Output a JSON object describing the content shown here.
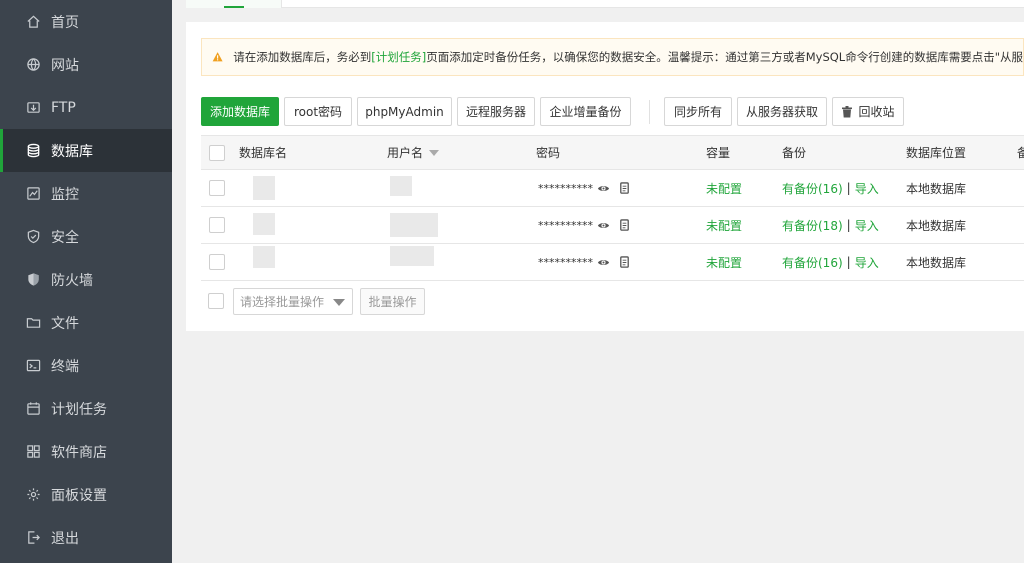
{
  "sidebar": {
    "items": [
      {
        "label": "首页",
        "icon": "home-icon"
      },
      {
        "label": "网站",
        "icon": "globe-icon"
      },
      {
        "label": "FTP",
        "icon": "ftp-icon"
      },
      {
        "label": "数据库",
        "icon": "database-icon",
        "active": true
      },
      {
        "label": "监控",
        "icon": "monitor-icon"
      },
      {
        "label": "安全",
        "icon": "shield-icon"
      },
      {
        "label": "防火墙",
        "icon": "firewall-icon"
      },
      {
        "label": "文件",
        "icon": "folder-icon"
      },
      {
        "label": "终端",
        "icon": "terminal-icon"
      },
      {
        "label": "计划任务",
        "icon": "calendar-icon"
      },
      {
        "label": "软件商店",
        "icon": "apps-icon"
      },
      {
        "label": "面板设置",
        "icon": "gear-icon"
      },
      {
        "label": "退出",
        "icon": "logout-icon"
      }
    ]
  },
  "notice": {
    "before": "请在添加数据库后，务必到",
    "link": "[计划任务]",
    "after": "页面添加定时备份任务，以确保您的数据安全。温馨提示：通过第三方或者MySQL命令行创建的数据库需要点击\"从服"
  },
  "toolbar": {
    "add_db": "添加数据库",
    "root_pwd": "root密码",
    "phpmyadmin": "phpMyAdmin",
    "remote_server": "远程服务器",
    "enterprise_backup": "企业增量备份",
    "sync_all": "同步所有",
    "fetch_from_server": "从服务器获取",
    "recycle_bin": "回收站"
  },
  "table": {
    "headers": {
      "db_name": "数据库名",
      "username": "用户名",
      "password": "密码",
      "capacity": "容量",
      "backup": "备份",
      "location": "数据库位置",
      "ops": "备"
    },
    "rows": [
      {
        "password": "**********",
        "capacity": "未配置",
        "backup": "有备份(16)",
        "import": "导入",
        "location": "本地数据库"
      },
      {
        "password": "**********",
        "capacity": "未配置",
        "backup": "有备份(18)",
        "import": "导入",
        "location": "本地数据库"
      },
      {
        "password": "**********",
        "capacity": "未配置",
        "backup": "有备份(16)",
        "import": "导入",
        "location": "本地数据库"
      }
    ],
    "separator": "|"
  },
  "batch": {
    "select_placeholder": "请选择批量操作",
    "button": "批量操作"
  },
  "colors": {
    "accent": "#20a53a",
    "sidebar_bg": "#3c444d",
    "sidebar_active": "#2c3238"
  }
}
